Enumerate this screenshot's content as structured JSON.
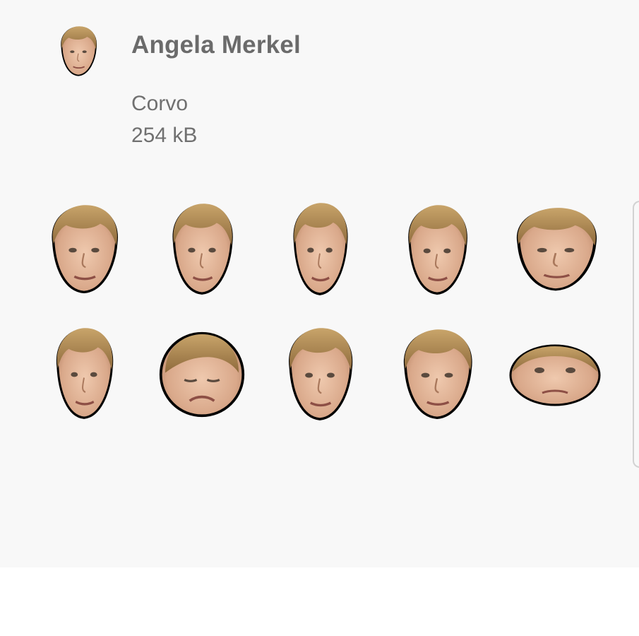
{
  "pack": {
    "title": "Angela Merkel",
    "author": "Corvo",
    "size": "254 kB"
  },
  "icons": {
    "header": "angela-merkel-face-icon"
  },
  "colors": {
    "background": "#f8f8f8",
    "title_text": "#6b6b6b",
    "meta_text": "#707070",
    "sticker_outline": "#000000",
    "skin": "#e2b89a",
    "hair": "#b48a52"
  },
  "stickers": [
    {
      "name": "sticker-1",
      "expression": "pout-upward-look"
    },
    {
      "name": "sticker-2",
      "expression": "neutral"
    },
    {
      "name": "sticker-3",
      "expression": "pursed-lips"
    },
    {
      "name": "sticker-4",
      "expression": "stern"
    },
    {
      "name": "sticker-5",
      "expression": "slight-smile"
    },
    {
      "name": "sticker-6",
      "expression": "big-smile"
    },
    {
      "name": "sticker-7",
      "expression": "frown-eyes-closed"
    },
    {
      "name": "sticker-8",
      "expression": "serious-hair-up"
    },
    {
      "name": "sticker-9",
      "expression": "grin-wink"
    },
    {
      "name": "sticker-10",
      "expression": "close-up-frown"
    }
  ]
}
